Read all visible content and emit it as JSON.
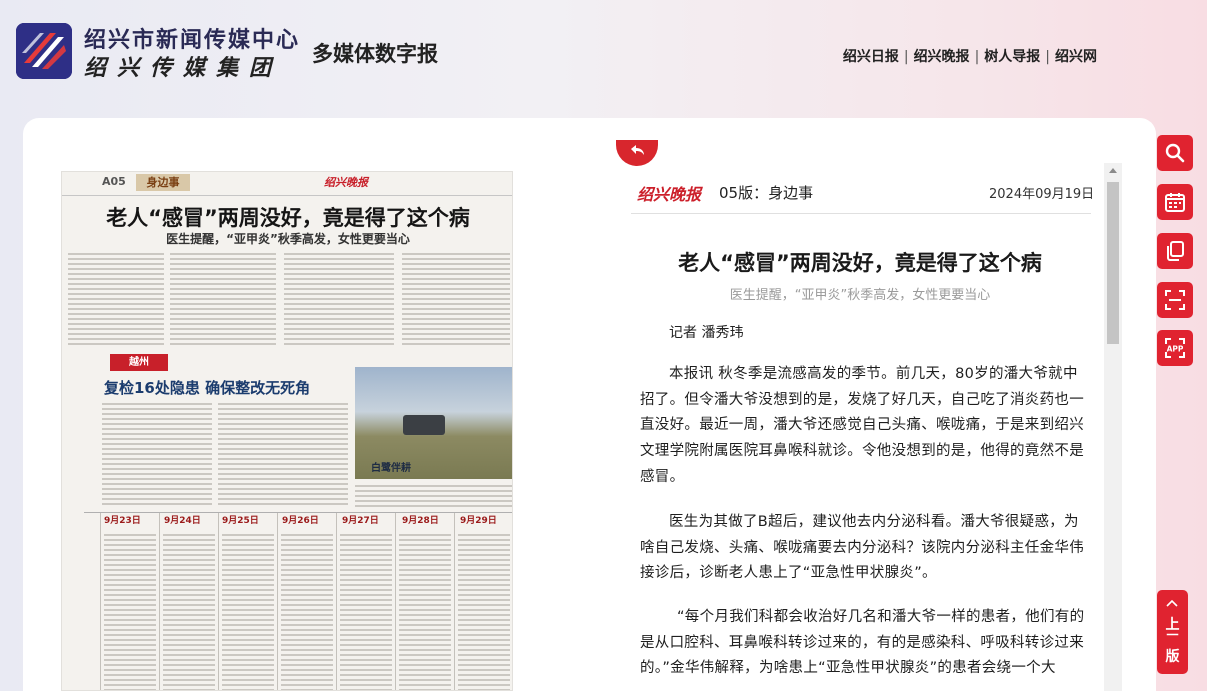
{
  "header": {
    "brand_line1": "绍兴市新闻传媒中心",
    "brand_line2": "绍兴传媒集团",
    "digital_title": "多媒体数字报",
    "links": [
      "绍兴日报",
      "绍兴晚报",
      "树人导报",
      "绍兴网"
    ],
    "separator": "|"
  },
  "paper_preview": {
    "page_code": "A05",
    "section_tag": "身边事",
    "masthead_logo": "绍兴晚报",
    "headline": "老人“感冒”两周没好，竟是得了这个病",
    "subheadline": "医生提醒，“亚甲炎”秋季高发，女性更要当心",
    "badge": "越州",
    "headline2": "复检16处隐患 确保整改无死角",
    "photo_caption": "白鹭伴耕",
    "schedule_days": [
      "9月23日",
      "9月24日",
      "9月25日",
      "9月26日",
      "9月27日",
      "9月28日",
      "9月29日"
    ]
  },
  "reader": {
    "paper_logo": "绍兴晚报",
    "edition": "05版：身边事",
    "date": "2024年09月19日",
    "title": "老人“感冒”两周没好，竟是得了这个病",
    "subtitle": "医生提醒，“亚甲炎”秋季高发，女性更要当心",
    "author": "记者 潘秀玮",
    "paragraphs": [
      "本报讯 秋冬季是流感高发的季节。前几天，80岁的潘大爷就中招了。但令潘大爷没想到的是，发烧了好几天，自己吃了消炎药也一直没好。最近一周，潘大爷还感觉自己头痛、喉咙痛，于是来到绍兴文理学院附属医院耳鼻喉科就诊。令他没想到的是，他得的竟然不是感冒。",
      "医生为其做了B超后，建议他去内分泌科看。潘大爷很疑惑，为啥自己发烧、头痛、喉咙痛要去内分泌科？该院内分泌科主任金华伟接诊后，诊断老人患上了“亚急性甲状腺炎”。",
      "“每个月我们科都会收治好几名和潘大爷一样的患者，他们有的是从口腔科、耳鼻喉科转诊过来的，有的是感染科、呼吸科转诊过来的。”金华伟解释，为啥患上“亚急性甲状腺炎”的患者会绕一个大"
    ]
  },
  "tools": {
    "icons": [
      "search-icon",
      "calendar-icon",
      "copy-icon",
      "scan-icon",
      "app-icon"
    ],
    "app_label": "APP",
    "up_label_1": "上",
    "up_label_2": "一",
    "up_label_3": "版"
  },
  "colors": {
    "accent": "#e02330",
    "brand_navy": "#2e2f86"
  }
}
